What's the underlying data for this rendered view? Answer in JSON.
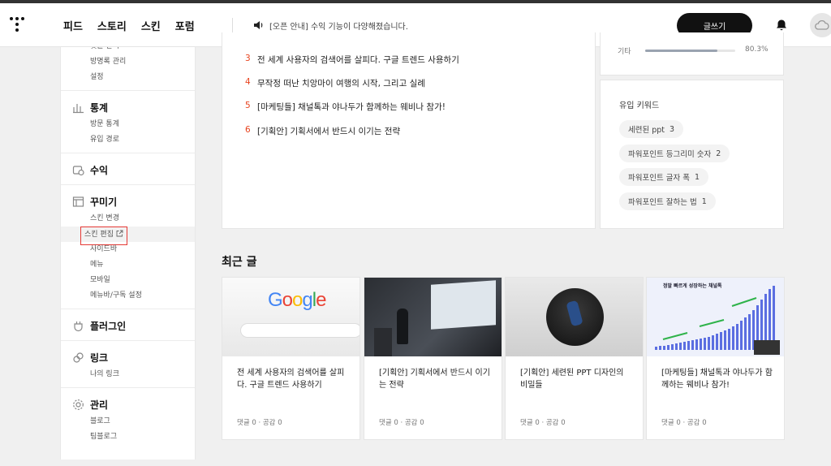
{
  "header": {
    "nav": [
      "피드",
      "스토리",
      "스킨",
      "포럼"
    ],
    "notice": "[오픈 안내] 수익 기능이 다양해졌습니다.",
    "write_label": "글쓰기"
  },
  "sidebar": {
    "top_items": [
      "댓글 관리",
      "방명록 관리",
      "설정"
    ],
    "groups": [
      {
        "title": "통계",
        "icon": "chart-icon",
        "items": [
          "방문 통계",
          "유입 경로"
        ]
      },
      {
        "title": "수익",
        "icon": "revenue-icon",
        "items": []
      },
      {
        "title": "꾸미기",
        "icon": "layout-icon",
        "items": [
          "스킨 변경",
          "스킨 편집",
          "사이드바",
          "메뉴",
          "모바일",
          "메뉴바/구독 설정"
        ]
      },
      {
        "title": "플러그인",
        "icon": "plugin-icon",
        "items": []
      },
      {
        "title": "링크",
        "icon": "link-icon",
        "items": [
          "나의 링크"
        ]
      },
      {
        "title": "관리",
        "icon": "gear-icon",
        "items": [
          "블로그",
          "팀블로그"
        ]
      }
    ]
  },
  "popular_posts": [
    {
      "num": "3",
      "title": "전 세계 사용자의 검색어를 살피다. 구글 트렌드 사용하기"
    },
    {
      "num": "4",
      "title": "무작정 떠난 치앙마이 여행의 시작, 그리고 실례"
    },
    {
      "num": "5",
      "title": "[마케팅들] 채널톡과 야나두가 함께하는 웨비나 참가!"
    },
    {
      "num": "6",
      "title": "[기획안] 기획서에서 반드시 이기는 전략"
    }
  ],
  "referrer": {
    "label": "기타",
    "percent": "80.3%",
    "fill": 0.803
  },
  "keywords": {
    "title": "유입 키워드",
    "items": [
      {
        "text": "세련된 ppt",
        "count": "3"
      },
      {
        "text": "파워포인트 등그리미 숫자",
        "count": "2"
      },
      {
        "text": "파워포인트 글자 폭",
        "count": "1"
      },
      {
        "text": "파워포인트 잘하는 법",
        "count": "1"
      }
    ]
  },
  "recent": {
    "title": "최근 글",
    "posts": [
      {
        "title": "전 세계 사용자의 검색어를 살피다. 구글 트렌드 사용하기",
        "meta": "댓글 0 · 공감 0",
        "thumb_text": "Google"
      },
      {
        "title": "[기획안] 기획서에서 반드시 이기는 전략",
        "meta": "댓글 0 · 공감 0"
      },
      {
        "title": "[기획안] 세련된 PPT 디자인의 비밀들",
        "meta": "댓글 0 · 공감 0"
      },
      {
        "title": "[마케팅들] 채널톡과 야나두가 함께하는 웨비나 참가!",
        "meta": "댓글 0 · 공감 0",
        "thumb_text": "정말 빠르게 성장하는 채널톡"
      }
    ]
  },
  "colors": {
    "accent_number": "#e8431e",
    "highlight_box": "#e53935"
  }
}
